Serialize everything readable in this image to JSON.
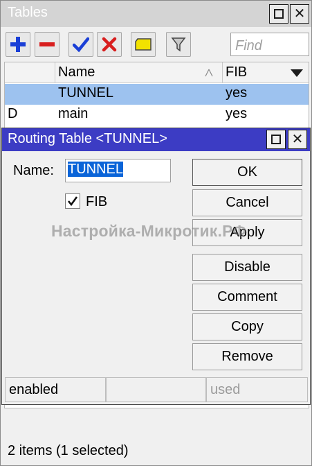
{
  "window": {
    "title": "Tables",
    "toolbar": {
      "find_placeholder": "Find"
    },
    "table": {
      "columns": [
        "",
        "Name",
        "FIB"
      ],
      "rows": [
        {
          "flag": "",
          "name": "TUNNEL",
          "fib": "yes",
          "selected": true
        },
        {
          "flag": "D",
          "name": "main",
          "fib": "yes",
          "selected": false
        }
      ]
    },
    "footer": "2 items (1 selected)"
  },
  "dialog": {
    "title": "Routing Table <TUNNEL>",
    "name_label": "Name:",
    "name_value": "TUNNEL",
    "fib_label": "FIB",
    "fib_checked": true,
    "buttons": {
      "ok": "OK",
      "cancel": "Cancel",
      "apply": "Apply",
      "disable": "Disable",
      "comment": "Comment",
      "copy": "Copy",
      "remove": "Remove"
    },
    "status": {
      "left": "enabled",
      "middle": "",
      "right": "used"
    }
  },
  "watermark": "Настройка-Микротик.РФ",
  "colors": {
    "dialog_title_bg": "#3c3cc4",
    "selected_row_bg": "#9dc2ef",
    "text_selection_bg": "#0a64d8",
    "add_icon": "#1a3fd6",
    "remove_icon": "#d81e1e",
    "enable_icon": "#1a3fd6",
    "disable_icon": "#d81e1e",
    "comment_icon": "#f2e200"
  },
  "icons": [
    "add-icon",
    "remove-icon",
    "enable-check-icon",
    "disable-x-icon",
    "comment-icon",
    "filter-icon",
    "maximize-icon",
    "close-icon",
    "sort-icon",
    "dropdown-arrow-icon",
    "checkmark-icon"
  ]
}
